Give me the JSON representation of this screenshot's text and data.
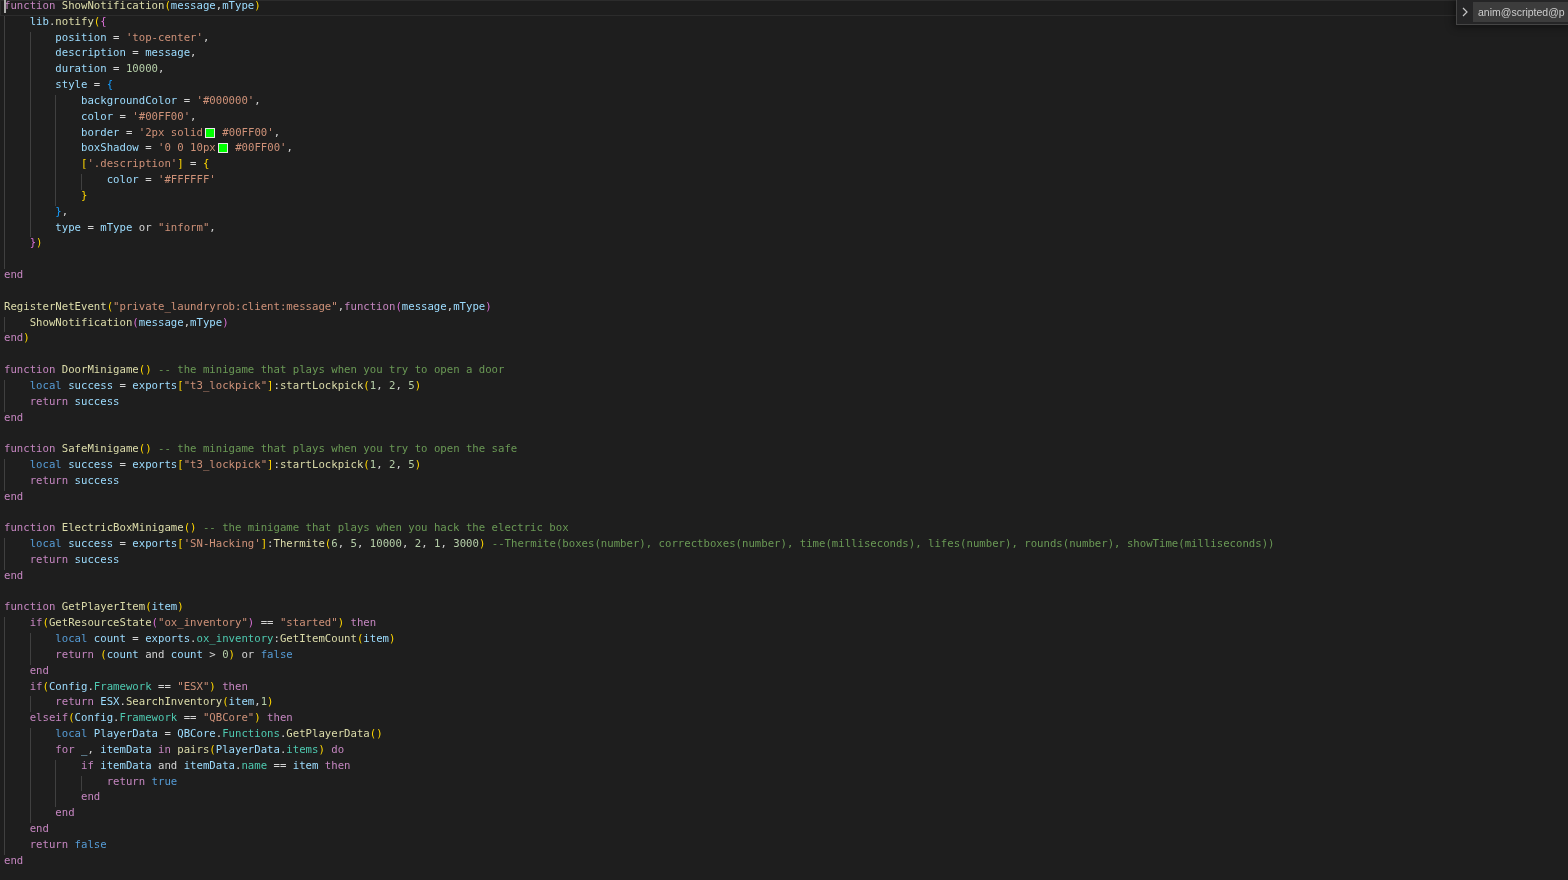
{
  "editor": {
    "lines": [
      {
        "cursor": true,
        "tokens": [
          {
            "kind": "keyword",
            "text": "function "
          },
          {
            "kind": "function",
            "text": "ShowNotification"
          },
          {
            "kind": "open",
            "text": "("
          },
          {
            "kind": "variable",
            "text": "message"
          },
          {
            "kind": "plain",
            "text": ","
          },
          {
            "kind": "variable",
            "text": "mType"
          },
          {
            "kind": "close",
            "text": ")"
          }
        ],
        "children": [
          {
            "cursor": false,
            "tokens": [
              {
                "kind": "variable",
                "text": "lib"
              },
              {
                "kind": "plain",
                "text": "."
              },
              {
                "kind": "function",
                "text": "notify"
              },
              {
                "kind": "open",
                "text": "("
              },
              {
                "kind": "open",
                "text": "{"
              }
            ],
            "children": [
              {
                "cursor": false,
                "tokens": [
                  {
                    "kind": "variable",
                    "text": "position"
                  },
                  {
                    "kind": "plain",
                    "text": " = "
                  },
                  {
                    "kind": "string",
                    "text": "'top-center'"
                  },
                  {
                    "kind": "plain",
                    "text": ","
                  }
                ]
              },
              {
                "cursor": false,
                "tokens": [
                  {
                    "kind": "variable",
                    "text": "description"
                  },
                  {
                    "kind": "plain",
                    "text": " = "
                  },
                  {
                    "kind": "variable",
                    "text": "message"
                  },
                  {
                    "kind": "plain",
                    "text": ","
                  }
                ]
              },
              {
                "cursor": false,
                "tokens": [
                  {
                    "kind": "variable",
                    "text": "duration"
                  },
                  {
                    "kind": "plain",
                    "text": " = "
                  },
                  {
                    "kind": "number",
                    "text": "10000"
                  },
                  {
                    "kind": "plain",
                    "text": ","
                  }
                ]
              },
              {
                "cursor": false,
                "tokens": [
                  {
                    "kind": "variable",
                    "text": "style"
                  },
                  {
                    "kind": "plain",
                    "text": " = "
                  },
                  {
                    "kind": "open",
                    "text": "{"
                  }
                ],
                "children": [
                  {
                    "cursor": false,
                    "tokens": [
                      {
                        "kind": "variable",
                        "text": "backgroundColor"
                      },
                      {
                        "kind": "plain",
                        "text": " = "
                      },
                      {
                        "kind": "string",
                        "text": "'#000000'"
                      },
                      {
                        "kind": "plain",
                        "text": ","
                      }
                    ]
                  },
                  {
                    "cursor": false,
                    "tokens": [
                      {
                        "kind": "variable",
                        "text": "color"
                      },
                      {
                        "kind": "plain",
                        "text": " = "
                      },
                      {
                        "kind": "string",
                        "text": "'#00FF00'"
                      },
                      {
                        "kind": "plain",
                        "text": ","
                      }
                    ]
                  },
                  {
                    "cursor": false,
                    "tokens": [
                      {
                        "kind": "variable",
                        "text": "border"
                      },
                      {
                        "kind": "plain",
                        "text": " = "
                      },
                      {
                        "kind": "string",
                        "text": "'2px solid"
                      },
                      {
                        "kind": "swatch",
                        "color": "#00ff00"
                      },
                      {
                        "kind": "string",
                        "text": " #00FF00'"
                      },
                      {
                        "kind": "plain",
                        "text": ","
                      }
                    ]
                  },
                  {
                    "cursor": false,
                    "tokens": [
                      {
                        "kind": "variable",
                        "text": "boxShadow"
                      },
                      {
                        "kind": "plain",
                        "text": " = "
                      },
                      {
                        "kind": "string",
                        "text": "'0 0 10px"
                      },
                      {
                        "kind": "swatch",
                        "color": "#00ff00"
                      },
                      {
                        "kind": "string",
                        "text": " #00FF00'"
                      },
                      {
                        "kind": "plain",
                        "text": ","
                      }
                    ]
                  },
                  {
                    "cursor": false,
                    "tokens": [
                      {
                        "kind": "open",
                        "text": "["
                      },
                      {
                        "kind": "string",
                        "text": "'.description'"
                      },
                      {
                        "kind": "close",
                        "text": "]"
                      },
                      {
                        "kind": "plain",
                        "text": " = "
                      },
                      {
                        "kind": "open",
                        "text": "{"
                      }
                    ],
                    "children": [
                      {
                        "cursor": false,
                        "tokens": [
                          {
                            "kind": "variable",
                            "text": "color"
                          },
                          {
                            "kind": "plain",
                            "text": " = "
                          },
                          {
                            "kind": "string",
                            "text": "'#FFFFFF'"
                          }
                        ]
                      }
                    ]
                  },
                  {
                    "cursor": false,
                    "tokens": [
                      {
                        "kind": "close",
                        "text": "}"
                      }
                    ]
                  }
                ]
              },
              {
                "cursor": false,
                "tokens": [
                  {
                    "kind": "close",
                    "text": "}"
                  },
                  {
                    "kind": "plain",
                    "text": ","
                  }
                ]
              },
              {
                "cursor": false,
                "tokens": [
                  {
                    "kind": "variable",
                    "text": "type"
                  },
                  {
                    "kind": "plain",
                    "text": " = "
                  },
                  {
                    "kind": "variable",
                    "text": "mType"
                  },
                  {
                    "kind": "plain",
                    "text": " or "
                  },
                  {
                    "kind": "string",
                    "text": "\"inform\""
                  },
                  {
                    "kind": "plain",
                    "text": ","
                  }
                ]
              }
            ]
          },
          {
            "cursor": false,
            "tokens": [
              {
                "kind": "close",
                "text": "}"
              },
              {
                "kind": "close",
                "text": ")"
              }
            ]
          },
          {
            "cursor": false
          }
        ]
      },
      {
        "cursor": false,
        "tokens": [
          {
            "kind": "keyword",
            "text": "end"
          }
        ]
      },
      {
        "cursor": false
      },
      {
        "cursor": false,
        "tokens": [
          {
            "kind": "function",
            "text": "RegisterNetEvent"
          },
          {
            "kind": "open",
            "text": "("
          },
          {
            "kind": "string",
            "text": "\"private_laundryrob:client:message\""
          },
          {
            "kind": "plain",
            "text": ","
          },
          {
            "kind": "keyword",
            "text": "function"
          },
          {
            "kind": "open",
            "text": "("
          },
          {
            "kind": "variable",
            "text": "message"
          },
          {
            "kind": "plain",
            "text": ","
          },
          {
            "kind": "variable",
            "text": "mType"
          },
          {
            "kind": "close",
            "text": ")"
          }
        ],
        "children": [
          {
            "cursor": false,
            "tokens": [
              {
                "kind": "function",
                "text": "ShowNotification"
              },
              {
                "kind": "open",
                "text": "("
              },
              {
                "kind": "variable",
                "text": "message"
              },
              {
                "kind": "plain",
                "text": ","
              },
              {
                "kind": "variable",
                "text": "mType"
              },
              {
                "kind": "close",
                "text": ")"
              }
            ]
          }
        ]
      },
      {
        "cursor": false,
        "tokens": [
          {
            "kind": "keyword",
            "text": "end"
          },
          {
            "kind": "close",
            "text": ")"
          }
        ]
      },
      {
        "cursor": false
      },
      {
        "cursor": false,
        "tokens": [
          {
            "kind": "keyword",
            "text": "function "
          },
          {
            "kind": "function",
            "text": "DoorMinigame"
          },
          {
            "kind": "open",
            "text": "("
          },
          {
            "kind": "close",
            "text": ")"
          },
          {
            "kind": "comment",
            "text": " -- the minigame that plays when you try to open a door"
          }
        ],
        "children": [
          {
            "cursor": false,
            "tokens": [
              {
                "kind": "storage",
                "text": "local "
              },
              {
                "kind": "variable",
                "text": "success"
              },
              {
                "kind": "plain",
                "text": " = "
              },
              {
                "kind": "variable",
                "text": "exports"
              },
              {
                "kind": "open",
                "text": "["
              },
              {
                "kind": "string",
                "text": "\"t3_lockpick\""
              },
              {
                "kind": "close",
                "text": "]"
              },
              {
                "kind": "plain",
                "text": ":"
              },
              {
                "kind": "function",
                "text": "startLockpick"
              },
              {
                "kind": "open",
                "text": "("
              },
              {
                "kind": "number",
                "text": "1"
              },
              {
                "kind": "plain",
                "text": ", "
              },
              {
                "kind": "number",
                "text": "2"
              },
              {
                "kind": "plain",
                "text": ", "
              },
              {
                "kind": "number",
                "text": "5"
              },
              {
                "kind": "close",
                "text": ")"
              }
            ]
          },
          {
            "cursor": false,
            "tokens": [
              {
                "kind": "keyword",
                "text": "return "
              },
              {
                "kind": "variable",
                "text": "success"
              }
            ]
          }
        ]
      },
      {
        "cursor": false,
        "tokens": [
          {
            "kind": "keyword",
            "text": "end"
          }
        ]
      },
      {
        "cursor": false
      },
      {
        "cursor": false,
        "tokens": [
          {
            "kind": "keyword",
            "text": "function "
          },
          {
            "kind": "function",
            "text": "SafeMinigame"
          },
          {
            "kind": "open",
            "text": "("
          },
          {
            "kind": "close",
            "text": ")"
          },
          {
            "kind": "comment",
            "text": " -- the minigame that plays when you try to open the safe"
          }
        ],
        "children": [
          {
            "cursor": false,
            "tokens": [
              {
                "kind": "storage",
                "text": "local "
              },
              {
                "kind": "variable",
                "text": "success"
              },
              {
                "kind": "plain",
                "text": " = "
              },
              {
                "kind": "variable",
                "text": "exports"
              },
              {
                "kind": "open",
                "text": "["
              },
              {
                "kind": "string",
                "text": "\"t3_lockpick\""
              },
              {
                "kind": "close",
                "text": "]"
              },
              {
                "kind": "plain",
                "text": ":"
              },
              {
                "kind": "function",
                "text": "startLockpick"
              },
              {
                "kind": "open",
                "text": "("
              },
              {
                "kind": "number",
                "text": "1"
              },
              {
                "kind": "plain",
                "text": ", "
              },
              {
                "kind": "number",
                "text": "2"
              },
              {
                "kind": "plain",
                "text": ", "
              },
              {
                "kind": "number",
                "text": "5"
              },
              {
                "kind": "close",
                "text": ")"
              }
            ]
          },
          {
            "cursor": false,
            "tokens": [
              {
                "kind": "keyword",
                "text": "return "
              },
              {
                "kind": "variable",
                "text": "success"
              }
            ]
          }
        ]
      },
      {
        "cursor": false,
        "tokens": [
          {
            "kind": "keyword",
            "text": "end"
          }
        ]
      },
      {
        "cursor": false
      },
      {
        "cursor": false,
        "tokens": [
          {
            "kind": "keyword",
            "text": "function "
          },
          {
            "kind": "function",
            "text": "ElectricBoxMinigame"
          },
          {
            "kind": "open",
            "text": "("
          },
          {
            "kind": "close",
            "text": ")"
          },
          {
            "kind": "comment",
            "text": " -- the minigame that plays when you hack the electric box"
          }
        ],
        "children": [
          {
            "cursor": false,
            "tokens": [
              {
                "kind": "storage",
                "text": "local "
              },
              {
                "kind": "variable",
                "text": "success"
              },
              {
                "kind": "plain",
                "text": " = "
              },
              {
                "kind": "variable",
                "text": "exports"
              },
              {
                "kind": "open",
                "text": "["
              },
              {
                "kind": "string",
                "text": "'SN-Hacking'"
              },
              {
                "kind": "close",
                "text": "]"
              },
              {
                "kind": "plain",
                "text": ":"
              },
              {
                "kind": "function",
                "text": "Thermite"
              },
              {
                "kind": "open",
                "text": "("
              },
              {
                "kind": "number",
                "text": "6"
              },
              {
                "kind": "plain",
                "text": ", "
              },
              {
                "kind": "number",
                "text": "5"
              },
              {
                "kind": "plain",
                "text": ", "
              },
              {
                "kind": "number",
                "text": "10000"
              },
              {
                "kind": "plain",
                "text": ", "
              },
              {
                "kind": "number",
                "text": "2"
              },
              {
                "kind": "plain",
                "text": ", "
              },
              {
                "kind": "number",
                "text": "1"
              },
              {
                "kind": "plain",
                "text": ", "
              },
              {
                "kind": "number",
                "text": "3000"
              },
              {
                "kind": "close",
                "text": ")"
              },
              {
                "kind": "comment",
                "text": " --Thermite(boxes(number), correctboxes(number), time(milliseconds), lifes(number), rounds(number), showTime(milliseconds))"
              }
            ]
          },
          {
            "cursor": false,
            "tokens": [
              {
                "kind": "keyword",
                "text": "return "
              },
              {
                "kind": "variable",
                "text": "success"
              }
            ]
          }
        ]
      },
      {
        "cursor": false,
        "tokens": [
          {
            "kind": "keyword",
            "text": "end"
          }
        ]
      },
      {
        "cursor": false
      },
      {
        "cursor": false,
        "tokens": [
          {
            "kind": "keyword",
            "text": "function "
          },
          {
            "kind": "function",
            "text": "GetPlayerItem"
          },
          {
            "kind": "open",
            "text": "("
          },
          {
            "kind": "variable",
            "text": "item"
          },
          {
            "kind": "close",
            "text": ")"
          }
        ],
        "children": [
          {
            "cursor": false,
            "tokens": [
              {
                "kind": "keyword",
                "text": "if"
              },
              {
                "kind": "open",
                "text": "("
              },
              {
                "kind": "function",
                "text": "GetResourceState"
              },
              {
                "kind": "open",
                "text": "("
              },
              {
                "kind": "string",
                "text": "\"ox_inventory\""
              },
              {
                "kind": "close",
                "text": ")"
              },
              {
                "kind": "plain",
                "text": " == "
              },
              {
                "kind": "string",
                "text": "\"started\""
              },
              {
                "kind": "close",
                "text": ")"
              },
              {
                "kind": "keyword",
                "text": " then"
              }
            ],
            "children": [
              {
                "cursor": false,
                "tokens": [
                  {
                    "kind": "storage",
                    "text": "local "
                  },
                  {
                    "kind": "variable",
                    "text": "count"
                  },
                  {
                    "kind": "plain",
                    "text": " = "
                  },
                  {
                    "kind": "variable",
                    "text": "exports"
                  },
                  {
                    "kind": "plain",
                    "text": "."
                  },
                  {
                    "kind": "property",
                    "text": "ox_inventory"
                  },
                  {
                    "kind": "plain",
                    "text": ":"
                  },
                  {
                    "kind": "function",
                    "text": "GetItemCount"
                  },
                  {
                    "kind": "open",
                    "text": "("
                  },
                  {
                    "kind": "variable",
                    "text": "item"
                  },
                  {
                    "kind": "close",
                    "text": ")"
                  }
                ]
              },
              {
                "cursor": false,
                "tokens": [
                  {
                    "kind": "keyword",
                    "text": "return "
                  },
                  {
                    "kind": "open",
                    "text": "("
                  },
                  {
                    "kind": "variable",
                    "text": "count"
                  },
                  {
                    "kind": "plain",
                    "text": " and "
                  },
                  {
                    "kind": "variable",
                    "text": "count"
                  },
                  {
                    "kind": "plain",
                    "text": " > "
                  },
                  {
                    "kind": "number",
                    "text": "0"
                  },
                  {
                    "kind": "close",
                    "text": ")"
                  },
                  {
                    "kind": "plain",
                    "text": " or "
                  },
                  {
                    "kind": "storage",
                    "text": "false"
                  }
                ]
              }
            ]
          },
          {
            "cursor": false,
            "tokens": [
              {
                "kind": "keyword",
                "text": "end"
              }
            ]
          },
          {
            "cursor": false,
            "tokens": [
              {
                "kind": "keyword",
                "text": "if"
              },
              {
                "kind": "open",
                "text": "("
              },
              {
                "kind": "variable",
                "text": "Config"
              },
              {
                "kind": "plain",
                "text": "."
              },
              {
                "kind": "property",
                "text": "Framework"
              },
              {
                "kind": "plain",
                "text": " == "
              },
              {
                "kind": "string",
                "text": "\"ESX\""
              },
              {
                "kind": "close",
                "text": ")"
              },
              {
                "kind": "keyword",
                "text": " then"
              }
            ],
            "children": [
              {
                "cursor": false,
                "tokens": [
                  {
                    "kind": "keyword",
                    "text": "return "
                  },
                  {
                    "kind": "variable",
                    "text": "ESX"
                  },
                  {
                    "kind": "plain",
                    "text": "."
                  },
                  {
                    "kind": "function",
                    "text": "SearchInventory"
                  },
                  {
                    "kind": "open",
                    "text": "("
                  },
                  {
                    "kind": "variable",
                    "text": "item"
                  },
                  {
                    "kind": "plain",
                    "text": ","
                  },
                  {
                    "kind": "number",
                    "text": "1"
                  },
                  {
                    "kind": "close",
                    "text": ")"
                  }
                ]
              }
            ]
          },
          {
            "cursor": false,
            "tokens": [
              {
                "kind": "keyword",
                "text": "elseif"
              },
              {
                "kind": "open",
                "text": "("
              },
              {
                "kind": "variable",
                "text": "Config"
              },
              {
                "kind": "plain",
                "text": "."
              },
              {
                "kind": "property",
                "text": "Framework"
              },
              {
                "kind": "plain",
                "text": " == "
              },
              {
                "kind": "string",
                "text": "\"QBCore\""
              },
              {
                "kind": "close",
                "text": ")"
              },
              {
                "kind": "keyword",
                "text": " then"
              }
            ],
            "children": [
              {
                "cursor": false,
                "tokens": [
                  {
                    "kind": "storage",
                    "text": "local "
                  },
                  {
                    "kind": "variable",
                    "text": "PlayerData"
                  },
                  {
                    "kind": "plain",
                    "text": " = "
                  },
                  {
                    "kind": "variable",
                    "text": "QBCore"
                  },
                  {
                    "kind": "plain",
                    "text": "."
                  },
                  {
                    "kind": "property",
                    "text": "Functions"
                  },
                  {
                    "kind": "plain",
                    "text": "."
                  },
                  {
                    "kind": "function",
                    "text": "GetPlayerData"
                  },
                  {
                    "kind": "open",
                    "text": "("
                  },
                  {
                    "kind": "close",
                    "text": ")"
                  }
                ]
              },
              {
                "cursor": false,
                "tokens": [
                  {
                    "kind": "keyword",
                    "text": "for "
                  },
                  {
                    "kind": "variable",
                    "text": "_"
                  },
                  {
                    "kind": "plain",
                    "text": ", "
                  },
                  {
                    "kind": "variable",
                    "text": "itemData"
                  },
                  {
                    "kind": "keyword",
                    "text": " in "
                  },
                  {
                    "kind": "function",
                    "text": "pairs"
                  },
                  {
                    "kind": "open",
                    "text": "("
                  },
                  {
                    "kind": "variable",
                    "text": "PlayerData"
                  },
                  {
                    "kind": "plain",
                    "text": "."
                  },
                  {
                    "kind": "property",
                    "text": "items"
                  },
                  {
                    "kind": "close",
                    "text": ")"
                  },
                  {
                    "kind": "keyword",
                    "text": " do"
                  }
                ],
                "children": [
                  {
                    "cursor": false,
                    "tokens": [
                      {
                        "kind": "keyword",
                        "text": "if "
                      },
                      {
                        "kind": "variable",
                        "text": "itemData"
                      },
                      {
                        "kind": "plain",
                        "text": " and "
                      },
                      {
                        "kind": "variable",
                        "text": "itemData"
                      },
                      {
                        "kind": "plain",
                        "text": "."
                      },
                      {
                        "kind": "property",
                        "text": "name"
                      },
                      {
                        "kind": "plain",
                        "text": " == "
                      },
                      {
                        "kind": "variable",
                        "text": "item"
                      },
                      {
                        "kind": "keyword",
                        "text": " then"
                      }
                    ],
                    "children": [
                      {
                        "cursor": false,
                        "tokens": [
                          {
                            "kind": "keyword",
                            "text": "return "
                          },
                          {
                            "kind": "storage",
                            "text": "true"
                          }
                        ]
                      }
                    ]
                  },
                  {
                    "cursor": false,
                    "tokens": [
                      {
                        "kind": "keyword",
                        "text": "end"
                      }
                    ]
                  }
                ]
              },
              {
                "cursor": false,
                "tokens": [
                  {
                    "kind": "keyword",
                    "text": "end"
                  }
                ]
              }
            ]
          },
          {
            "cursor": false,
            "tokens": [
              {
                "kind": "keyword",
                "text": "end"
              }
            ]
          },
          {
            "cursor": false,
            "tokens": [
              {
                "kind": "keyword",
                "text": "return "
              },
              {
                "kind": "storage",
                "text": "false"
              }
            ]
          }
        ]
      },
      {
        "cursor": false,
        "tokens": [
          {
            "kind": "keyword",
            "text": "end"
          }
        ]
      }
    ]
  },
  "find_widget": {
    "replace_expanded": false,
    "value": "anim@scripted@p"
  }
}
